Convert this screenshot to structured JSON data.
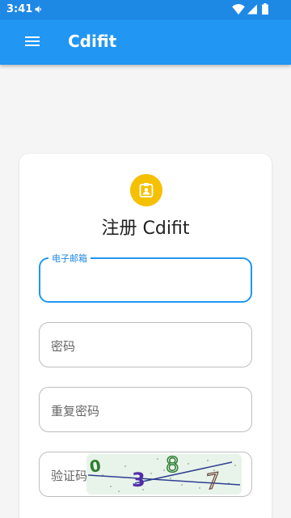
{
  "status_bar": {
    "time": "3:41"
  },
  "app_bar": {
    "title": "Cdifit"
  },
  "register": {
    "heading": "注册 Cdifit",
    "email": {
      "label": "电子邮箱",
      "value": ""
    },
    "password": {
      "placeholder": "密码"
    },
    "repeat_password": {
      "placeholder": "重复密码"
    },
    "captcha": {
      "placeholder": "验证码",
      "chars": [
        "0",
        "3",
        "8",
        "7"
      ]
    }
  },
  "colors": {
    "primary": "#2196f3",
    "status_bar": "#1e88e5",
    "badge": "#f5c000"
  },
  "icons": {
    "menu": "menu-icon",
    "badge": "contact-badge-icon"
  }
}
